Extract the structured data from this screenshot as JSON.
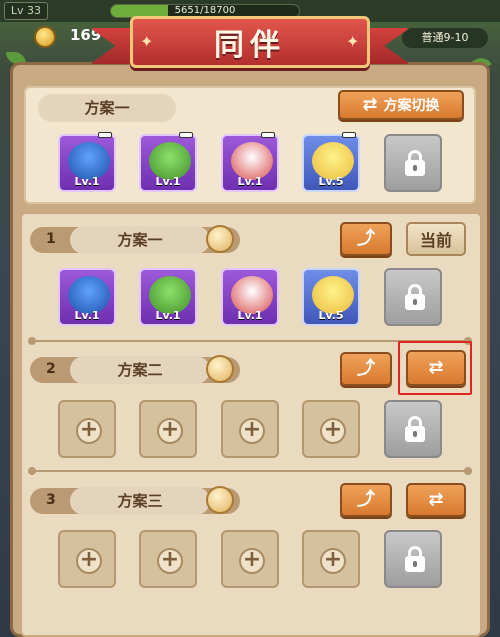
{
  "topbar": {
    "level": "Lv 33",
    "xp_text": "5651/18700",
    "xp_progress": 0.302,
    "coins": "169",
    "stage": "普通9-10"
  },
  "title": "同伴",
  "current_team": {
    "label": "方案一",
    "switch_button": "方案切换",
    "heroes": [
      {
        "level": "Lv.1",
        "color": "purple",
        "icon": "bottle-hero-icon"
      },
      {
        "level": "Lv.1",
        "color": "purple",
        "icon": "green-bird-hero-icon"
      },
      {
        "level": "Lv.1",
        "color": "purple",
        "icon": "white-bird-hero-icon"
      },
      {
        "level": "Lv.5",
        "color": "blue",
        "icon": "chick-hero-icon"
      }
    ]
  },
  "schemes": [
    {
      "number": "1",
      "name": "方案一",
      "status_button": "当前",
      "heroes": [
        {
          "level": "Lv.1",
          "color": "purple",
          "icon": "bottle-hero-icon"
        },
        {
          "level": "Lv.1",
          "color": "purple",
          "icon": "green-bird-hero-icon"
        },
        {
          "level": "Lv.1",
          "color": "purple",
          "icon": "white-bird-hero-icon"
        },
        {
          "level": "Lv.5",
          "color": "blue",
          "icon": "chick-hero-icon"
        }
      ]
    },
    {
      "number": "2",
      "name": "方案二",
      "status_button": ""
    },
    {
      "number": "3",
      "name": "方案三",
      "status_button": ""
    }
  ]
}
